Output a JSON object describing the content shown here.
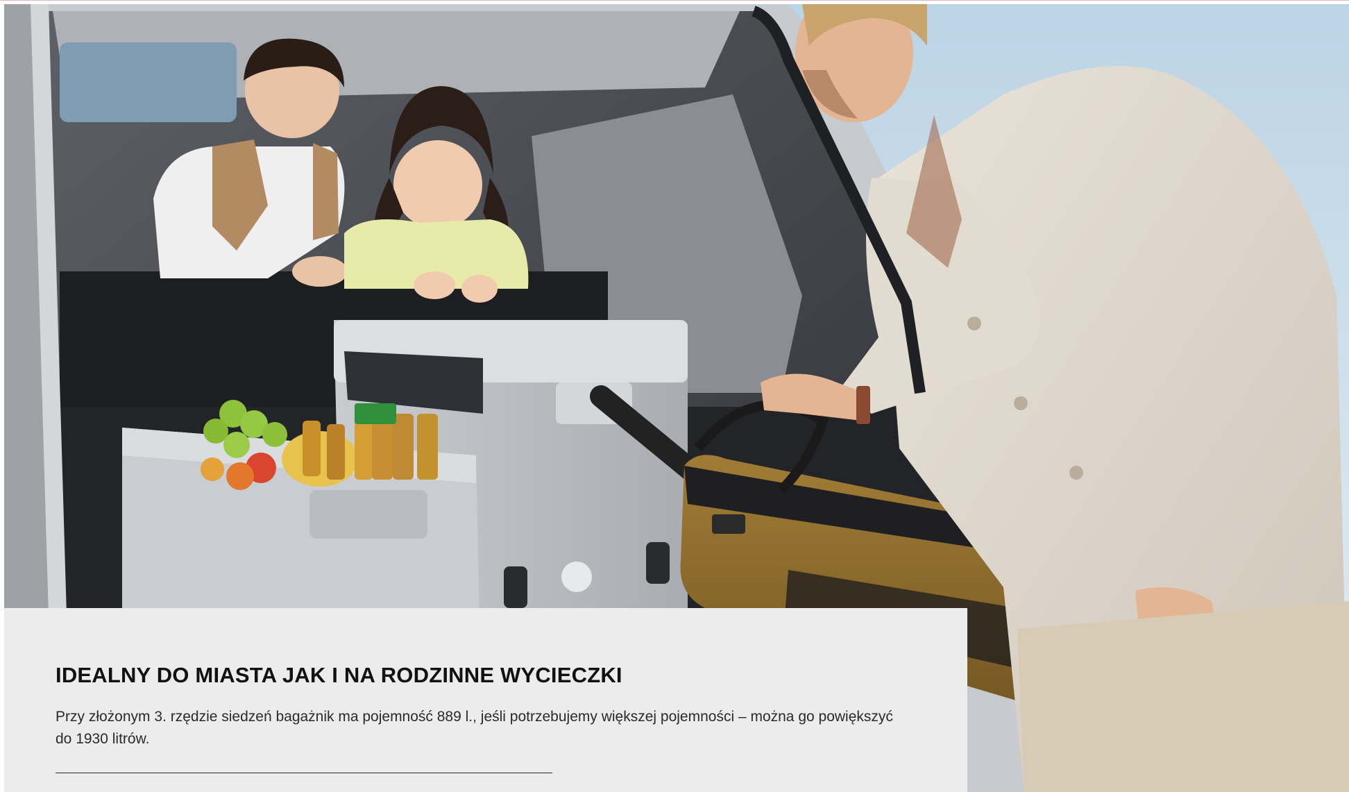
{
  "hero": {
    "photo": "family-loading-car-trunk-photo",
    "colors": {
      "sky": "#c9dcea",
      "interior": "#3b3d42",
      "cardigan": "#ddd5ca",
      "golf_bag": "#8b6a2c"
    }
  },
  "info_card": {
    "title": "IDEALNY DO MIASTA JAK I NA RODZINNE WYCIECZKI",
    "text": "Przy złożonym 3. rzędzie siedzeń bagażnik ma pojemność 889 l., jeśli potrzebujemy większej pojemności – można go powiększyć do 1930 litrów.",
    "background": "#ececec"
  }
}
